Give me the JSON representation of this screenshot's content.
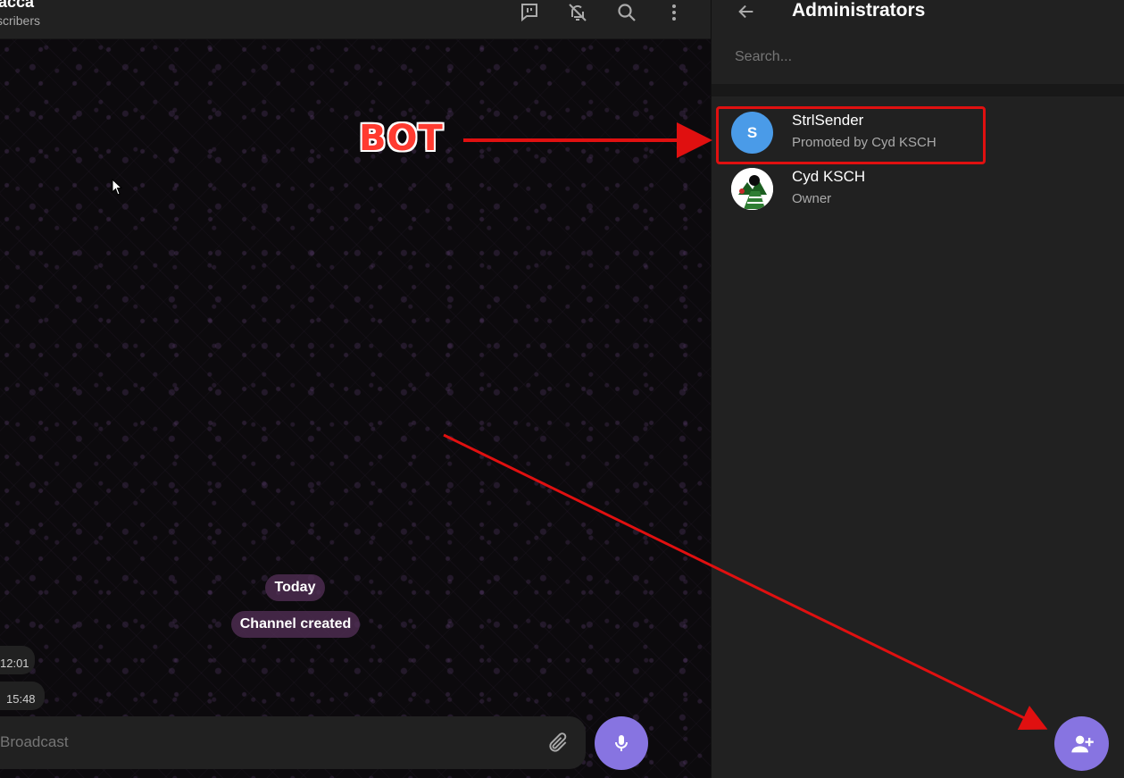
{
  "chat": {
    "title": "acca",
    "subtitle": "scribers",
    "date_pill": "Today",
    "service_message": "Channel created",
    "messages": [
      {
        "time": "12:01"
      },
      {
        "time": "15:48"
      }
    ],
    "composer_placeholder": "Broadcast",
    "header_icons": [
      "discussion-icon",
      "mute-bell-icon",
      "search-icon",
      "more-vertical-icon"
    ]
  },
  "panel": {
    "title": "Administrators",
    "search_placeholder": "Search...",
    "admins": [
      {
        "avatar_letter": "S",
        "name": "StrlSender",
        "role": "Promoted by Cyd KSCH",
        "avatar_color": "#4a9be8"
      },
      {
        "avatar_letter": "",
        "name": "Cyd KSCH",
        "role": "Owner",
        "avatar_color": "#ffffff"
      }
    ]
  },
  "annotation": {
    "label": "BOT",
    "color": "#e01010"
  },
  "colors": {
    "accent": "#8774e1",
    "panel_bg": "#212121",
    "date_pill_bg": "#543058"
  }
}
